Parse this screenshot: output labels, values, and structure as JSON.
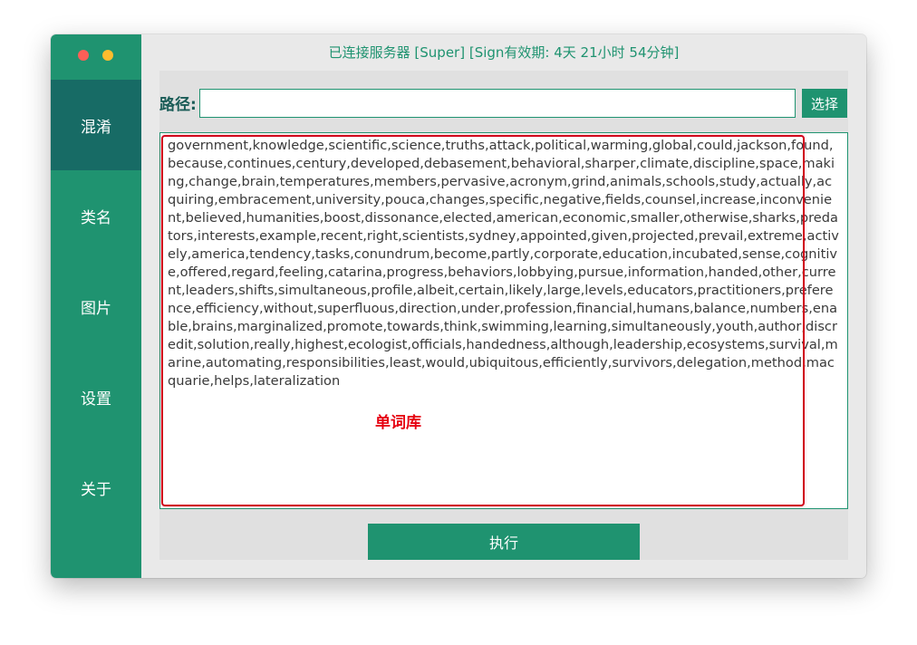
{
  "window": {
    "traffic_lights": [
      "close",
      "minimize"
    ]
  },
  "status": {
    "text": "已连接服务器 [Super] [Sign有效期: 4天 21小时 54分钟]"
  },
  "sidebar": {
    "items": [
      {
        "label": "混淆",
        "active": true
      },
      {
        "label": "类名",
        "active": false
      },
      {
        "label": "图片",
        "active": false
      },
      {
        "label": "设置",
        "active": false
      },
      {
        "label": "关于",
        "active": false
      }
    ]
  },
  "path": {
    "label": "路径:",
    "value": "",
    "choose_label": "选择"
  },
  "words": {
    "content": "government,knowledge,scientific,science,truths,attack,political,warming,global,could,jackson,found,because,continues,century,developed,debasement,behavioral,sharper,climate,discipline,space,making,change,brain,temperatures,members,pervasive,acronym,grind,animals,schools,study,actually,acquiring,embracement,university,pouca,changes,specific,negative,fields,counsel,increase,inconvenient,believed,humanities,boost,dissonance,elected,american,economic,smaller,otherwise,sharks,predators,interests,example,recent,right,scientists,sydney,appointed,given,projected,prevail,extreme,actively,america,tendency,tasks,conundrum,become,partly,corporate,education,incubated,sense,cognitive,offered,regard,feeling,catarina,progress,behaviors,lobbying,pursue,information,handed,other,current,leaders,shifts,simultaneous,profile,albeit,certain,likely,large,levels,educators,practitioners,preference,efficiency,without,superfluous,direction,under,profession,financial,humans,balance,numbers,enable,brains,marginalized,promote,towards,think,swimming,learning,simultaneously,youth,author,discredit,solution,really,highest,ecologist,officials,handedness,although,leadership,ecosystems,survival,marine,automating,responsibilities,least,would,ubiquitous,efficiently,survivors,delegation,method,macquarie,helps,lateralization"
  },
  "annotation": {
    "label": "单词库",
    "color": "#d0021b"
  },
  "run": {
    "label": "执行"
  },
  "colors": {
    "accent": "#1f9370",
    "sidebar_active": "#176b65",
    "annotation": "#d0021b"
  }
}
